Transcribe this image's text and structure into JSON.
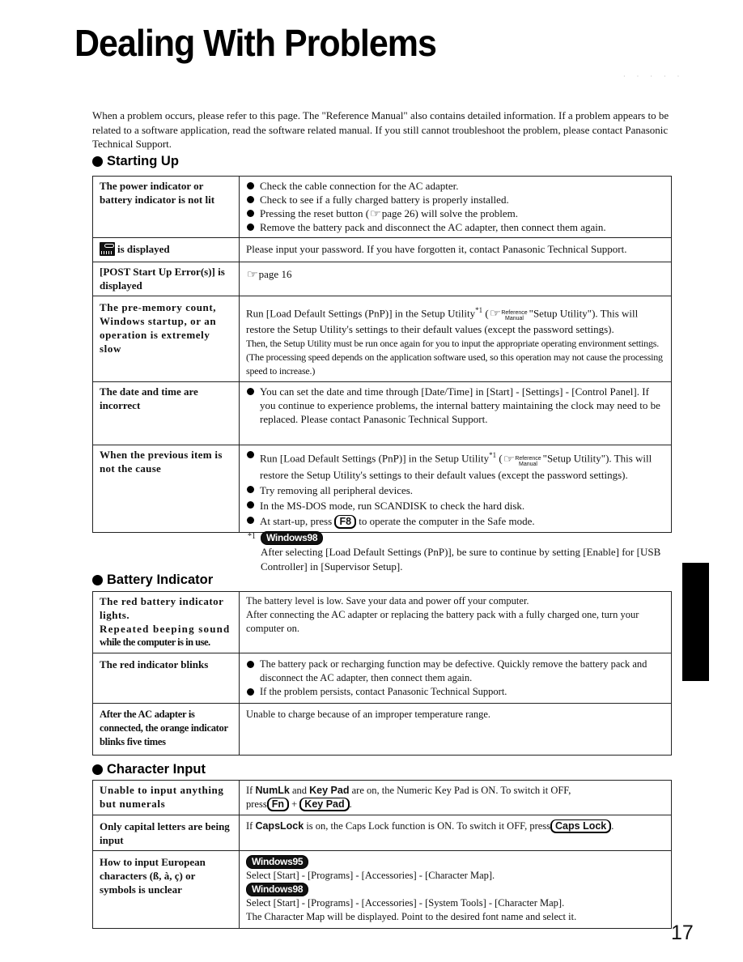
{
  "page": {
    "title": "Dealing With Problems",
    "intro": "When a problem occurs, please refer to this page.  The \"Reference Manual\" also contains detailed information.  If a problem appears to be related to a software application, read the software related manual.  If you still cannot troubleshoot the problem, please contact Panasonic Technical Support.",
    "page_number": "17",
    "accent_color": "#000000"
  },
  "icons": {
    "section_bullet": "filled-circle",
    "list_bullet": "filled-circle",
    "reference": "pointing-hand",
    "password": "key-password-icon"
  },
  "sections": {
    "starting_up": {
      "heading": "Starting Up",
      "rows": {
        "power": {
          "problem": "The power indicator or battery indicator is not lit",
          "bullets": [
            "Check the cable connection for the AC adapter.",
            "Check to see if a fully charged battery is properly installed.",
            "Pressing the reset button (",
            "Remove the battery pack and disconnect the AC adapter, then connect them again."
          ],
          "bullet3_ref": "page 26",
          "bullet3_tail": ") will solve the problem."
        },
        "password": {
          "problem_suffix": "is displayed",
          "solution": "Please input your password.  If you have forgotten it, contact Panasonic Technical Support."
        },
        "post": {
          "problem": "[POST Start Up Error(s)] is displayed",
          "solution_ref": "page 16"
        },
        "slow": {
          "problem": "The pre-memory count, Windows startup, or an operation is extremely slow",
          "solution_a": "Run [Load Default Settings (PnP)] in the Setup Utility",
          "footnote_mark": "*1",
          "ref_open": " (",
          "ref_top": "Reference",
          "ref_bottom": "Manual",
          "ref_target": "\"Setup Utility\").  This will restore the Setup Utility's settings to their default values (except the password settings).",
          "solution_b": "Then, the Setup Utility must be run once again for you to input the appropriate operating environment settings.  (The processing speed depends on the application software used, so this operation may not cause the processing speed to increase.)"
        },
        "datetime": {
          "problem": "The date and time are incorrect",
          "solution": "You can set the date and time through [Date/Time] in [Start] - [Settings] - [Control Panel].  If you continue to experience problems, the internal battery maintaining the clock may need to be replaced.  Please contact Panasonic Technical Support."
        },
        "previous": {
          "problem": "When the previous item is not the cause",
          "b1_a": "Run [Load Default Settings (PnP)] in the Setup Utility",
          "b1_mark": "*1",
          "b1_ref_open": " (",
          "b1_ref_top": "Reference",
          "b1_ref_bottom": "Manual",
          "b1_tail": "\"Setup Utility\").  This will restore the Setup Utility's settings to their default values (except the password settings).",
          "b2": "Try removing all peripheral devices.",
          "b3": "In the MS-DOS mode, run SCANDISK to check the hard disk.",
          "b4_a": "At start-up, press",
          "b4_key": "F8",
          "b4_b": "to operate the computer in the Safe mode."
        }
      },
      "footnote": {
        "mark": "*1",
        "badge": "Windows98",
        "text": "After selecting [Load Default Settings (PnP)], be sure to continue by setting [Enable] for [USB Controller] in [Supervisor Setup]."
      }
    },
    "battery": {
      "heading": "Battery Indicator",
      "rows": {
        "red_lights": {
          "problem_a": "The red battery indicator lights.",
          "problem_b": "Repeated beeping sound",
          "problem_c": "while the computer is in use.",
          "solution_a": "The battery level is low.  Save your data and power off your computer.",
          "solution_b": "After connecting the AC adapter or replacing the battery pack with a fully charged one, turn your computer on."
        },
        "red_blinks": {
          "problem": "The red indicator blinks",
          "bullets": [
            "The battery pack or recharging function may be defective.  Quickly remove the battery pack and disconnect the AC adapter, then connect them again.",
            "If the problem persists, contact Panasonic Technical Support."
          ]
        },
        "orange": {
          "problem": "After the AC adapter is connected, the orange indicator blinks five times",
          "solution": "Unable to charge because of an improper temperature range."
        }
      }
    },
    "character": {
      "heading": "Character Input",
      "rows": {
        "numerals": {
          "problem": "Unable to input anything but numerals",
          "s_if": "If",
          "s_kw1": "NumLk",
          "s_and": "and",
          "s_kw2": "Key Pad",
          "s_rest": "are on, the Numeric Key Pad is ON.  To switch it OFF,",
          "s_press": "press",
          "key1": "Fn",
          "plus": "+",
          "key2": "Key Pad",
          "end": "."
        },
        "capitals": {
          "problem": "Only capital letters are being input",
          "s_if": "If",
          "s_kw": "CapsLock",
          "s_rest": "is on, the Caps Lock function is ON.  To switch it OFF, press",
          "key": "Caps Lock",
          "end": "."
        },
        "european": {
          "problem": "How to input European characters (ß, à, ç) or symbols is unclear",
          "badge95": "Windows95",
          "line95": "Select [Start] - [Programs] - [Accessories] - [Character Map].",
          "badge98": "Windows98",
          "line98": "Select [Start] - [Programs] - [Accessories] - [System Tools] - [Character Map].",
          "line_end": "The Character Map will be displayed.  Point to the desired font name and select it."
        }
      }
    }
  }
}
